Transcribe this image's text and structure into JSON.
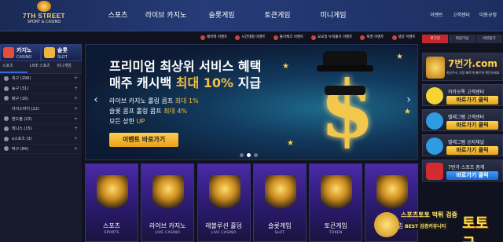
{
  "logo": {
    "title": "7TH STREET",
    "subtitle": "SPORT & CASINO"
  },
  "nav": [
    "스포츠",
    "라이브 카지노",
    "슬롯게임",
    "토큰게임",
    "미니게임"
  ],
  "topmenu": [
    "이벤트",
    "고객센터",
    "이용규정"
  ],
  "promos": [
    "페이백 이벤트",
    "시간대별 이벤트",
    "출석체크 이벤트",
    "요요일 누적출석 이벤트",
    "복권 이벤트",
    "댓글 이벤트"
  ],
  "left": {
    "casino": {
      "k": "카지노",
      "e": "CASINO"
    },
    "slot": {
      "k": "슬롯",
      "e": "SLOT"
    },
    "subtabs": [
      "스포츠",
      "LIVE 스포츠",
      "미니게임"
    ],
    "sports": [
      {
        "name": "축구 (296)"
      },
      {
        "name": "농구 (31)"
      },
      {
        "name": "배구 (16)"
      },
      {
        "name": "아이스하키 (22)"
      },
      {
        "name": "핸드볼 (23)"
      },
      {
        "name": "테니스 (15)"
      },
      {
        "name": "e스포츠 (3)"
      },
      {
        "name": "탁구 (84)"
      }
    ]
  },
  "banner": {
    "line1": "프리미엄 최상위 서비스 혜택",
    "line2_pre": "매주 캐시백 ",
    "line2_hl": "최대 10%",
    "line2_post": " 지급",
    "b1_pre": "라이브 카지노 롤링 콤프 ",
    "b1_hl": "최대 1%",
    "b2_pre": "슬롯 콤프 롤링 콤프 ",
    "b2_hl": "최대 4%",
    "b3_pre": "모든 상한 ",
    "b3_hl": "UP",
    "cta": "이벤트 바로가기"
  },
  "right": {
    "tabs": [
      "로그인",
      "회원가입",
      "비번찾기"
    ],
    "brand": "7번가.com",
    "brand_sub": "최신주소 가장 빠르게 빠르게 확인하세요",
    "cards": [
      {
        "title": "카카오톡 고객센터",
        "btn": "바로가기 클릭",
        "color": "#f5d531",
        "blue": false
      },
      {
        "title": "텔레그램 고객센터",
        "btn": "바로가기 클릭",
        "color": "#2f9be0",
        "blue": false
      },
      {
        "title": "텔레그램 공지채널",
        "btn": "바로가기 클릭",
        "color": "#2f9be0",
        "blue": false
      },
      {
        "title": "7번가 스포츠 중계",
        "btn": "바로가기 클릭",
        "color": "#d22b30",
        "blue": true
      }
    ]
  },
  "tiles": [
    {
      "k": "스포츠",
      "e": "SPORTS"
    },
    {
      "k": "라이브 카지노",
      "e": "LIVE CASINO"
    },
    {
      "k": "레볼루션 홀덤",
      "e": "LIVE CASINO"
    },
    {
      "k": "슬롯게임",
      "e": "SLOT"
    },
    {
      "k": "토큰게임",
      "e": "TOKEN"
    },
    {
      "k": "미니게임",
      "e": ""
    }
  ],
  "badge": {
    "k1": "스포츠토토 먹튀 검증",
    "k2": "BEST 검증커뮤니티",
    "big": "토토군"
  }
}
